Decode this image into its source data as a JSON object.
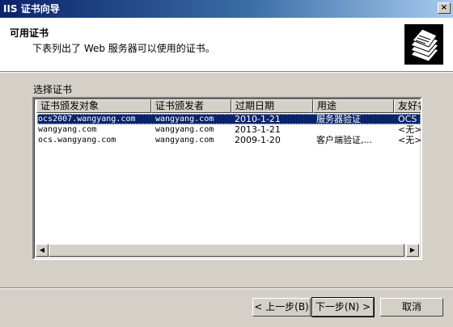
{
  "window": {
    "title": "IIS 证书向导",
    "close_glyph": "×"
  },
  "header": {
    "title": "可用证书",
    "subtitle": "下表列出了 Web 服务器可以使用的证书。",
    "icon": "certificate-stack-icon"
  },
  "certificates": {
    "label": "选择证书",
    "columns": [
      "证书颁发对象",
      "证书颁发者",
      "过期日期",
      "用途",
      "友好名"
    ],
    "rows": [
      {
        "issued_to": "ocs2007.wangyang.com",
        "issued_by": "wangyang.com",
        "expiry": "2010-1-21",
        "purpose": "服务器验证",
        "friendly_name": "OCS",
        "selected": true
      },
      {
        "issued_to": "wangyang.com",
        "issued_by": "wangyang.com",
        "expiry": "2013-1-21",
        "purpose": "",
        "friendly_name": "<无>",
        "selected": false
      },
      {
        "issued_to": "ocs.wangyang.com",
        "issued_by": "wangyang.com",
        "expiry": "2009-1-20",
        "purpose": "客户端验证,...",
        "friendly_name": "<无>",
        "selected": false
      }
    ]
  },
  "scrollbar": {
    "left_arrow": "◀",
    "right_arrow": "▶"
  },
  "buttons": {
    "back": "< 上一步(B)",
    "next": "下一步(N) >",
    "cancel": "取消"
  },
  "colors": {
    "selection": "#0a246a",
    "face": "#d4d0c8"
  }
}
